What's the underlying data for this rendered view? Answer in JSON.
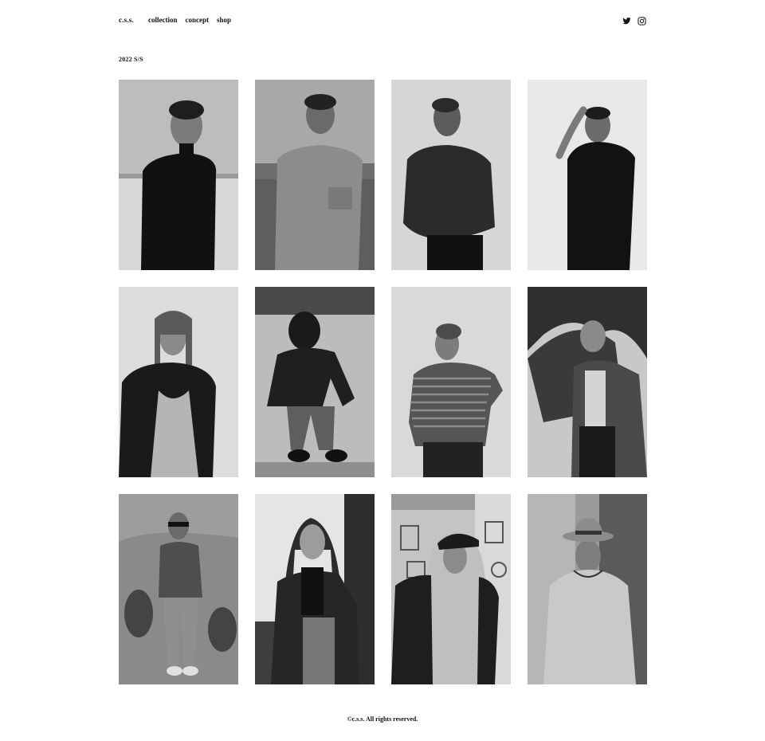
{
  "header": {
    "logo": "c.s.s.",
    "nav": [
      {
        "label": "collection"
      },
      {
        "label": "concept"
      },
      {
        "label": "shop"
      }
    ],
    "social": [
      {
        "icon": "twitter-icon"
      },
      {
        "icon": "instagram-icon"
      }
    ]
  },
  "main": {
    "season_title": "2022 S/S",
    "photos": [
      {
        "subject": "man-black-turtleneck-beach"
      },
      {
        "subject": "man-tshirt-beach"
      },
      {
        "subject": "man-knit-sweater"
      },
      {
        "subject": "man-black-shirt-hand-on-head"
      },
      {
        "subject": "woman-leather-jacket-dress"
      },
      {
        "subject": "person-crouching-jacket"
      },
      {
        "subject": "boy-striped-sweater"
      },
      {
        "subject": "woman-denim-jacket-trees"
      },
      {
        "subject": "woman-sunglasses-cactus"
      },
      {
        "subject": "woman-long-coat"
      },
      {
        "subject": "man-hoodie-cap"
      },
      {
        "subject": "man-hoodie-hat"
      }
    ]
  },
  "footer": {
    "copyright": "©c.s.s. All rights reserved."
  },
  "colors": {
    "text": "#111111",
    "background": "#ffffff"
  }
}
